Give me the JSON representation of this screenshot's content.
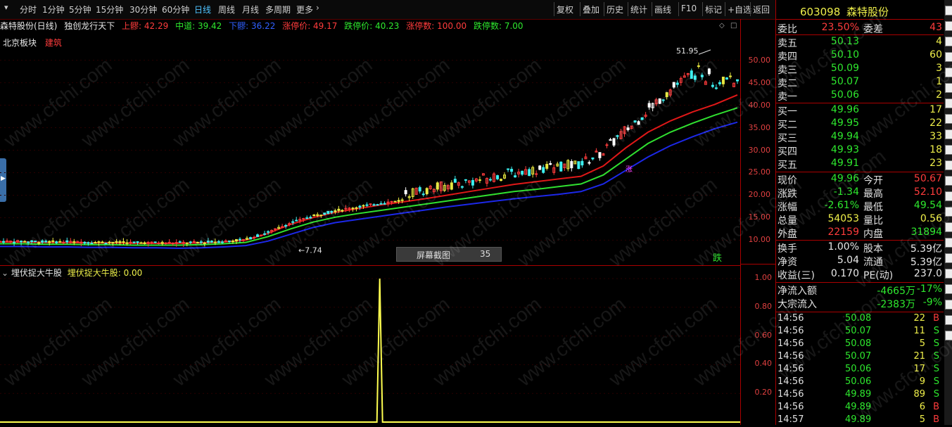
{
  "toolbar": {
    "periods": [
      "分时",
      "1分钟",
      "5分钟",
      "15分钟",
      "30分钟",
      "60分钟",
      "日线",
      "周线",
      "月线",
      "多周期",
      "更多"
    ],
    "active_period": "日线",
    "right_buttons": [
      "复权",
      "叠加",
      "历史",
      "统计",
      "画线",
      "F10",
      "标记",
      "+自选",
      "返回"
    ]
  },
  "title": {
    "stock": "森特股份(日线)",
    "indicator": "独创龙行天下",
    "upper_label": "上髎: 42.29",
    "mid_label": "中道: 39.42",
    "lower_label": "下髎: 36.22",
    "limit_up": "涨停价: 49.17",
    "limit_down": "跌停价: 40.23",
    "limit_up_count": "涨停数: 100.00",
    "limit_down_count": "跌停数: 7.00"
  },
  "sector": {
    "board": "北京板块",
    "industry": "建筑"
  },
  "chart_annotations": {
    "high": "51.95",
    "low": "7.74",
    "fall_marker": "跌",
    "rise_marker": "涨"
  },
  "screenshot_tip": {
    "label": "屏幕截图",
    "value": "35"
  },
  "price_axis": [
    "50.00",
    "45.00",
    "40.00",
    "35.00",
    "30.00",
    "25.00",
    "20.00",
    "15.00",
    "10.00"
  ],
  "indicator": {
    "name": "埋伏捉大牛股",
    "value_label": "埋伏捉大牛股: 0.00",
    "axis": [
      "1.00",
      "0.80",
      "0.60",
      "0.40",
      "0.20"
    ]
  },
  "watermark": "www.cfchi.com",
  "colors": {
    "up": "#ff3c3c",
    "down": "#2ee82e",
    "ma_red": "#e01818",
    "ma_green": "#30e030",
    "ma_blue": "#1c28e8",
    "indicator": "#ffff50"
  },
  "chart_data": {
    "type": "line",
    "ylim": [
      6,
      54
    ],
    "series": [
      {
        "name": "上髎",
        "values": [
          9.6,
          9.6,
          9.5,
          9.5,
          9.4,
          9.4,
          9.3,
          9.3,
          9.3,
          9.4,
          9.6,
          10.0,
          11.5,
          13.5,
          15.0,
          16.2,
          17.0,
          17.8,
          18.5,
          19.2,
          20.0,
          20.8,
          21.6,
          22.4,
          23.0,
          23.6,
          24.2,
          26.5,
          30.5,
          34.0,
          36.5,
          38.5,
          40.2,
          42.29
        ]
      },
      {
        "name": "中道",
        "values": [
          9.2,
          9.2,
          9.1,
          9.1,
          9.0,
          9.0,
          8.9,
          8.9,
          8.9,
          9.0,
          9.2,
          9.5,
          10.8,
          12.5,
          14.0,
          15.1,
          15.9,
          16.6,
          17.3,
          18.0,
          18.7,
          19.4,
          20.1,
          20.8,
          21.3,
          21.9,
          22.5,
          24.5,
          28.0,
          31.5,
          34.0,
          36.0,
          37.8,
          39.42
        ]
      },
      {
        "name": "下髎",
        "values": [
          8.6,
          8.6,
          8.5,
          8.5,
          8.4,
          8.4,
          8.3,
          8.3,
          8.2,
          8.3,
          8.5,
          8.8,
          9.8,
          11.3,
          12.8,
          13.9,
          14.6,
          15.3,
          16.0,
          16.7,
          17.4,
          18.0,
          18.6,
          19.2,
          19.7,
          20.2,
          20.8,
          22.5,
          25.5,
          28.5,
          31.0,
          33.0,
          34.8,
          36.22
        ]
      }
    ],
    "indicator_series": {
      "name": "埋伏捉大牛股",
      "spike_position": 0.513,
      "values": [
        0,
        1,
        0
      ]
    }
  },
  "panel": {
    "code": "603098",
    "name": "森特股份",
    "weibi": {
      "label": "委比",
      "value": "23.50%",
      "label2": "委差",
      "value2": "43"
    },
    "asks": [
      {
        "label": "卖五",
        "price": "50.13",
        "vol": "4"
      },
      {
        "label": "卖四",
        "price": "50.10",
        "vol": "60"
      },
      {
        "label": "卖三",
        "price": "50.09",
        "vol": "3"
      },
      {
        "label": "卖二",
        "price": "50.07",
        "vol": "1"
      },
      {
        "label": "卖一",
        "price": "50.06",
        "vol": "2"
      }
    ],
    "bids": [
      {
        "label": "买一",
        "price": "49.96",
        "vol": "17"
      },
      {
        "label": "买二",
        "price": "49.95",
        "vol": "22"
      },
      {
        "label": "买三",
        "price": "49.94",
        "vol": "33"
      },
      {
        "label": "买四",
        "price": "49.93",
        "vol": "18"
      },
      {
        "label": "买五",
        "price": "49.91",
        "vol": "23"
      }
    ],
    "quote": [
      {
        "l": "现价",
        "v": "49.96",
        "vc": "green",
        "l2": "今开",
        "v2": "50.67",
        "v2c": "red"
      },
      {
        "l": "涨跌",
        "v": "-1.34",
        "vc": "green",
        "l2": "最高",
        "v2": "52.10",
        "v2c": "red"
      },
      {
        "l": "涨幅",
        "v": "-2.61%",
        "vc": "green",
        "l2": "最低",
        "v2": "49.54",
        "v2c": "green"
      },
      {
        "l": "总量",
        "v": "54053",
        "vc": "yellow",
        "l2": "量比",
        "v2": "0.56",
        "v2c": "yellow"
      },
      {
        "l": "外盘",
        "v": "22159",
        "vc": "red",
        "l2": "内盘",
        "v2": "31894",
        "v2c": "green"
      }
    ],
    "fund": [
      {
        "l": "换手",
        "v": "1.00%",
        "vc": "white",
        "l2": "股本",
        "v2": "5.39亿",
        "v2c": "white"
      },
      {
        "l": "净资",
        "v": "5.04",
        "vc": "white",
        "l2": "流通",
        "v2": "5.39亿",
        "v2c": "white"
      },
      {
        "l": "收益(三)",
        "v": "0.170",
        "vc": "white",
        "l2": "PE(动)",
        "v2": "237.0",
        "v2c": "white"
      }
    ],
    "flow": [
      {
        "l": "净流入额",
        "v": "-4665万",
        "p": "-17%"
      },
      {
        "l": "大宗流入",
        "v": "-2383万",
        "p": "-9%"
      }
    ],
    "ticks": [
      {
        "t": "14:56",
        "p": "50.08",
        "v": "22",
        "s": "B"
      },
      {
        "t": "14:56",
        "p": "50.07",
        "v": "11",
        "s": "S"
      },
      {
        "t": "14:56",
        "p": "50.08",
        "v": "5",
        "s": "S"
      },
      {
        "t": "14:56",
        "p": "50.07",
        "v": "21",
        "s": "S"
      },
      {
        "t": "14:56",
        "p": "50.06",
        "v": "17",
        "s": "S"
      },
      {
        "t": "14:56",
        "p": "50.06",
        "v": "9",
        "s": "S"
      },
      {
        "t": "14:56",
        "p": "49.89",
        "v": "89",
        "s": "S"
      },
      {
        "t": "14:56",
        "p": "49.89",
        "v": "6",
        "s": "B"
      },
      {
        "t": "14:57",
        "p": "49.89",
        "v": "5",
        "s": "B"
      }
    ]
  }
}
